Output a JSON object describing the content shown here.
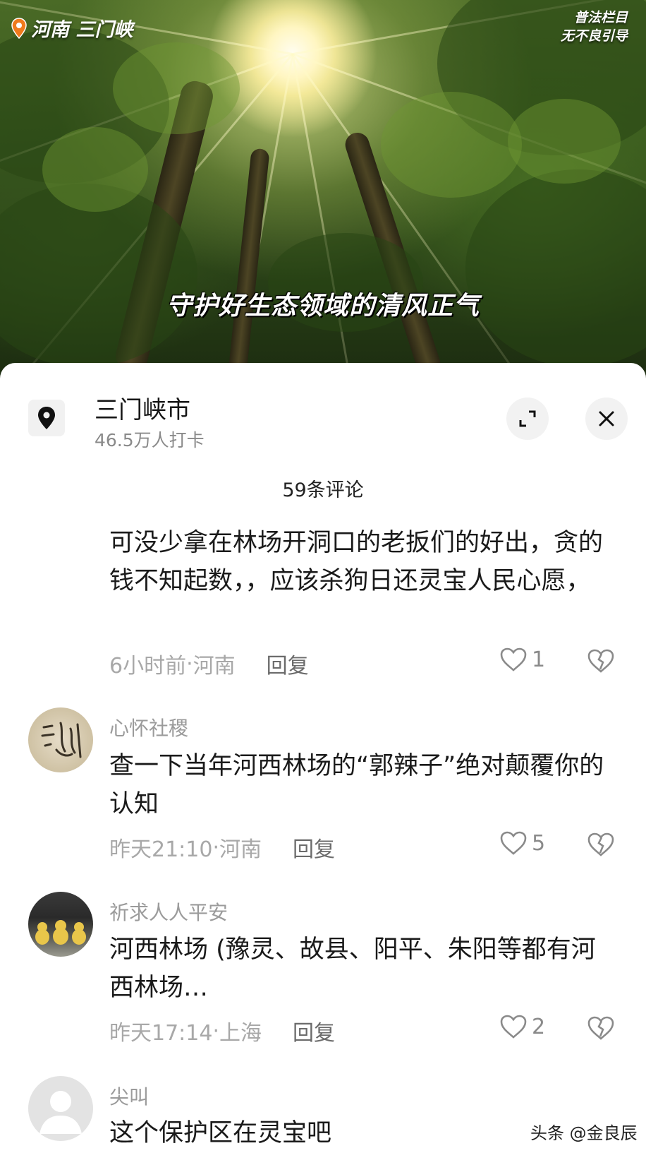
{
  "video": {
    "location_tag": "河南 三门峡",
    "legal_tag_line1": "普法栏目",
    "legal_tag_line2": "无不良引导",
    "subtitle": "守护好生态领域的清风正气"
  },
  "place": {
    "icon": "location-pin-icon",
    "name": "三门峡市",
    "checkins": "46.5万人打卡",
    "expand_icon": "expand-icon",
    "close_icon": "close-icon"
  },
  "comments_header": "59条评论",
  "comments": [
    {
      "text": "可没少拿在林场开洞口的老扳们的好出，贪的钱不知起数，，应该杀狗日还灵宝人民心愿，",
      "time": "6小时前",
      "region": "河南",
      "reply": "回复",
      "likes": "1"
    },
    {
      "name": "心怀社稷",
      "text": "查一下当年河西林场的“郭辣子”绝对颠覆你的认知",
      "time": "昨天21:10",
      "region": "河南",
      "reply": "回复",
      "likes": "5"
    },
    {
      "name": "祈求人人平安",
      "text": "河西林场 (豫灵、故县、阳平、朱阳等都有河西林场…",
      "time": "昨天17:14",
      "region": "上海",
      "reply": "回复",
      "likes": "2"
    },
    {
      "name": "尖叫",
      "text": "这个保护区在灵宝吧"
    }
  ],
  "meta_separator": " · ",
  "watermark": "头条 @金良辰"
}
